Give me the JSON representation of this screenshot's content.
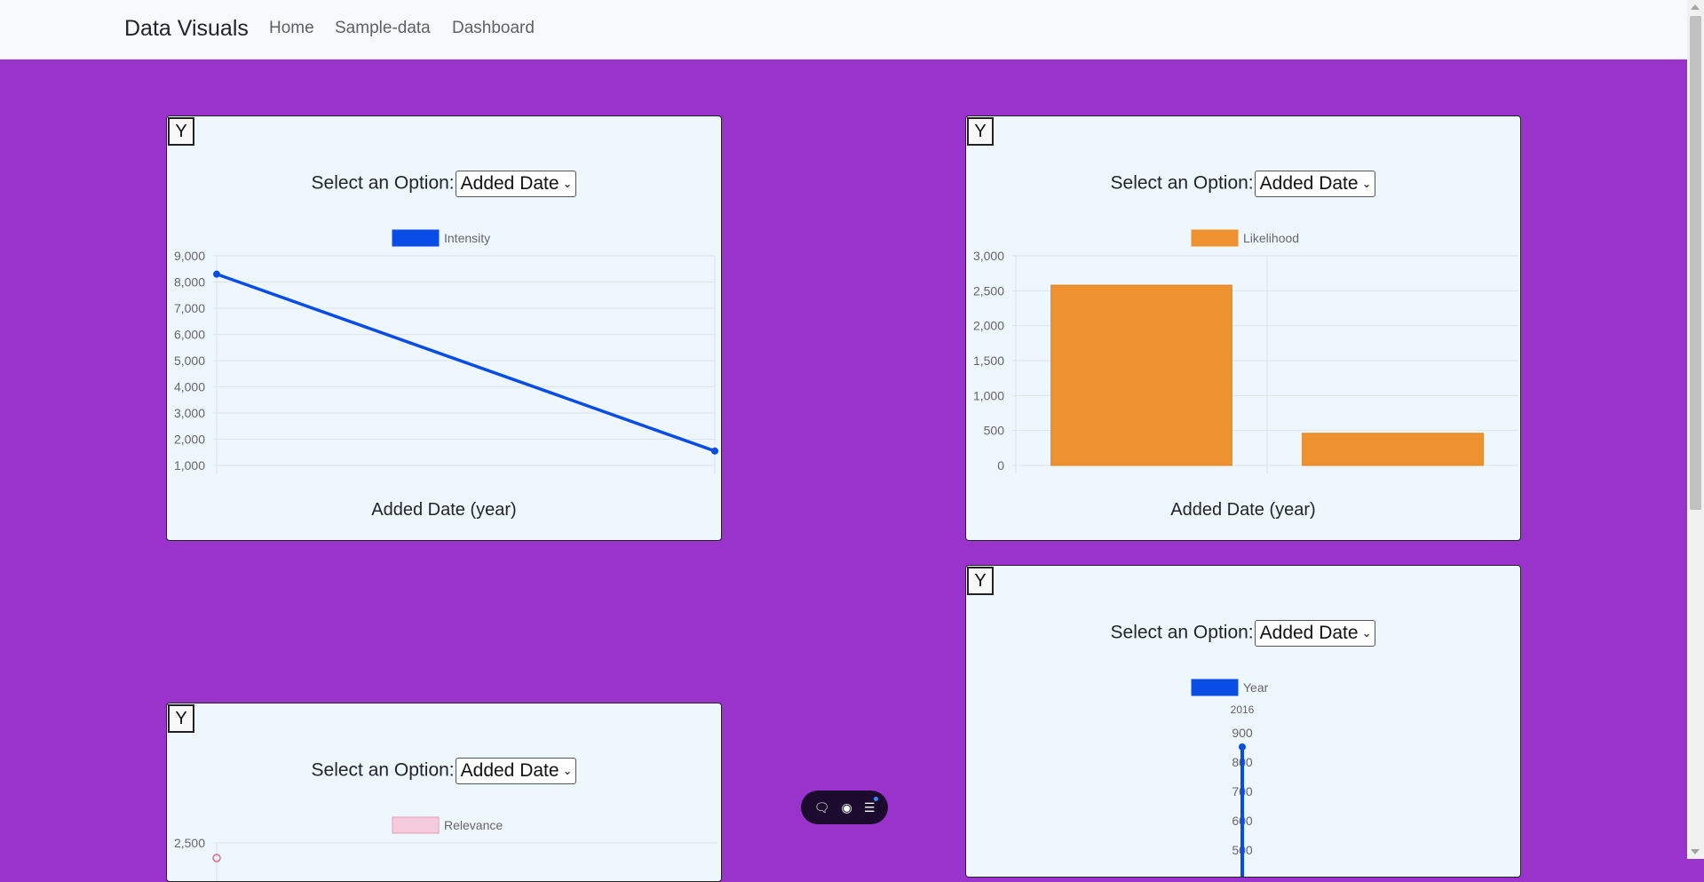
{
  "nav": {
    "brand": "Data Visuals",
    "links": [
      "Home",
      "Sample-data",
      "Dashboard"
    ]
  },
  "cards": [
    {
      "y_button": "Y",
      "select_label": "Select an Option:",
      "select_value": "Added Date",
      "x_axis_label": "Added Date (year)"
    },
    {
      "y_button": "Y",
      "select_label": "Select an Option:",
      "select_value": "Added Date",
      "x_axis_label": "Added Date (year)"
    },
    {
      "y_button": "Y",
      "select_label": "Select an Option:",
      "select_value": "Added Date"
    },
    {
      "y_button": "Y",
      "select_label": "Select an Option:",
      "select_value": "Added Date"
    }
  ],
  "chart_data": [
    {
      "type": "line",
      "series": [
        {
          "name": "Intensity",
          "values": [
            8300,
            1550
          ]
        }
      ],
      "ylim": [
        1000,
        9000
      ],
      "yticks": [
        "9,000",
        "8,000",
        "7,000",
        "6,000",
        "5,000",
        "4,000",
        "3,000",
        "2,000",
        "1,000"
      ],
      "xlabel": "Added Date (year)",
      "legend": "top",
      "color": "#0a4de6"
    },
    {
      "type": "bar",
      "series": [
        {
          "name": "Likelihood",
          "values": [
            2580,
            460
          ]
        }
      ],
      "ylim": [
        0,
        3000
      ],
      "yticks": [
        "3,000",
        "2,500",
        "2,000",
        "1,500",
        "1,000",
        "500",
        "0"
      ],
      "xlabel": "Added Date (year)",
      "legend": "top",
      "color": "#ee9130"
    },
    {
      "type": "line",
      "series": [
        {
          "name": "Relevance",
          "values": [
            2500
          ]
        }
      ],
      "yticks": [
        "2,500"
      ],
      "legend": "top",
      "color": "#f4ccdc"
    },
    {
      "type": "bar",
      "categories": [
        "2016"
      ],
      "series": [
        {
          "name": "Year",
          "values": [
            900
          ]
        }
      ],
      "yticks": [
        "900",
        "800",
        "700",
        "600",
        "500"
      ],
      "legend": "top",
      "color": "#0a4de6"
    }
  ],
  "floating_toolbar": {
    "icons": [
      "chat-icon",
      "eye-icon",
      "menu-icon"
    ]
  }
}
